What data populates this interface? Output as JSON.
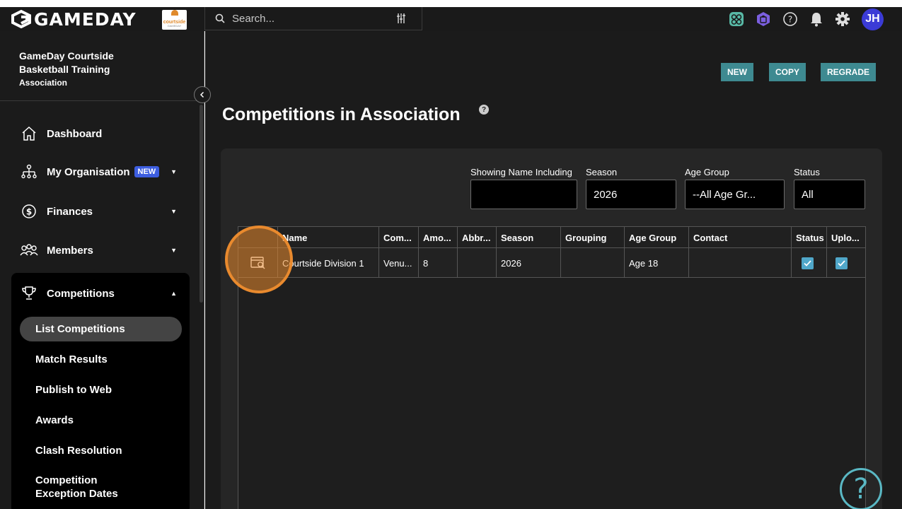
{
  "app": {
    "logo_text": "GAMEDAY",
    "partner_logo_text": "courtside",
    "partner_logo_sub": "GAMEDAY"
  },
  "search": {
    "placeholder": "Search..."
  },
  "header": {
    "avatar_initials": "JH"
  },
  "sidebar": {
    "org_line1": "GameDay Courtside",
    "org_line2": "Basketball Training",
    "org_line3": "Association",
    "items": [
      {
        "label": "Dashboard"
      },
      {
        "label": "My Organisation",
        "badge": "NEW"
      },
      {
        "label": "Finances"
      },
      {
        "label": "Members"
      },
      {
        "label": "Competitions"
      }
    ],
    "sub_items": [
      {
        "label": "List Competitions"
      },
      {
        "label": "Match Results"
      },
      {
        "label": "Publish to Web"
      },
      {
        "label": "Awards"
      },
      {
        "label": "Clash Resolution"
      },
      {
        "label": "Competition Exception Dates"
      }
    ]
  },
  "toolbar": {
    "new_label": "NEW",
    "copy_label": "COPY",
    "regrade_label": "REGRADE"
  },
  "page": {
    "title": "Competitions in Association"
  },
  "filters": {
    "name_label": "Showing Name Including",
    "name_value": "",
    "season_label": "Season",
    "season_value": "2026",
    "age_label": "Age Group",
    "age_value": "--All Age Gr...",
    "status_label": "Status",
    "status_value": "All"
  },
  "table": {
    "columns": [
      "Name",
      "Com...",
      "Amo...",
      "Abbr...",
      "Season",
      "Grouping",
      "Age Group",
      "Contact",
      "Status",
      "Uplo..."
    ],
    "rows": [
      {
        "name": "Courtside Division 1",
        "com": "Venu...",
        "amo": "8",
        "abbr": "",
        "season": "2026",
        "grouping": "",
        "age_group": "Age 18",
        "contact": "",
        "status": true,
        "upload": true
      }
    ]
  },
  "colors": {
    "accent": "#3e8a91",
    "highlight": "#e98a2e",
    "checkbox": "#50a7c9",
    "avatar": "#3b3bd6",
    "badge": "#3d5ee0"
  }
}
